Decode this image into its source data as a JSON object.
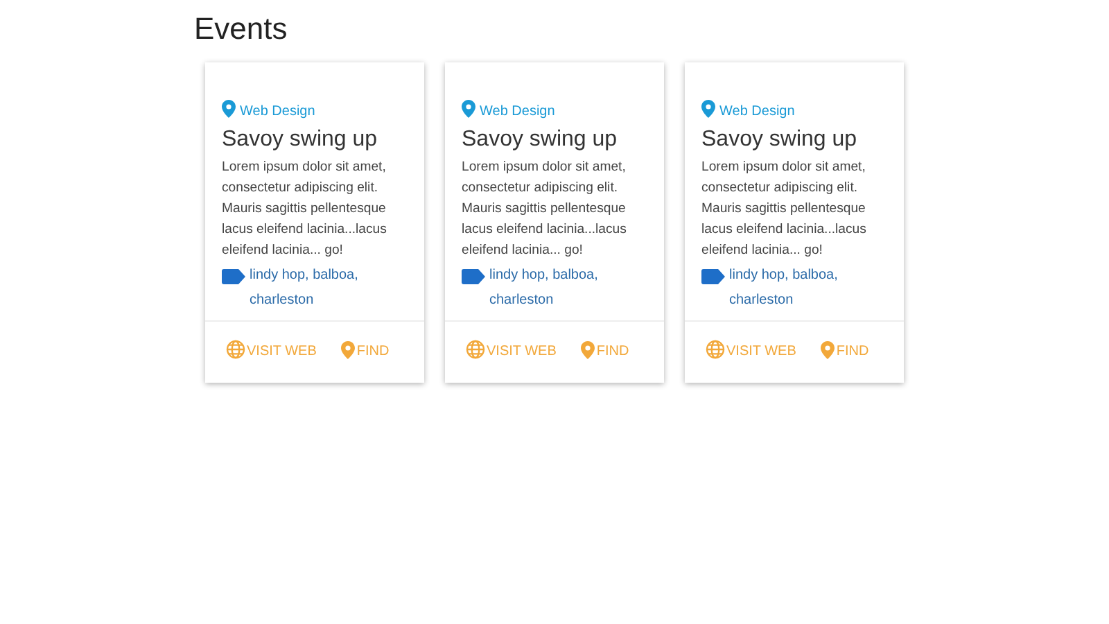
{
  "page": {
    "title": "Events"
  },
  "cards": [
    {
      "category": "Web Design",
      "title": "Savoy swing up",
      "description": "Lorem ipsum dolor sit amet, consectetur adipiscing elit. Mauris sagittis pellentesque lacus eleifend lacinia...lacus eleifend lacinia... go!",
      "tags": "lindy hop, balboa, charleston",
      "actions": [
        {
          "kind": "web",
          "label": "VISIT WEB"
        },
        {
          "kind": "find",
          "label": "FIND"
        }
      ]
    },
    {
      "category": "Web Design",
      "title": "Savoy swing up",
      "description": "Lorem ipsum dolor sit amet, consectetur adipiscing elit. Mauris sagittis pellentesque lacus eleifend lacinia...lacus eleifend lacinia... go!",
      "tags": "lindy hop, balboa, charleston",
      "actions": [
        {
          "kind": "web",
          "label": "VISIT WEB"
        },
        {
          "kind": "find",
          "label": "FIND"
        }
      ]
    },
    {
      "category": "Web Design",
      "title": "Savoy swing up",
      "description": "Lorem ipsum dolor sit amet, consectetur adipiscing elit. Mauris sagittis pellentesque lacus eleifend lacinia...lacus eleifend lacinia... go!",
      "tags": "lindy hop, balboa, charleston",
      "actions": [
        {
          "kind": "web",
          "label": "VISIT WEB"
        },
        {
          "kind": "find",
          "label": "FIND"
        }
      ]
    }
  ]
}
